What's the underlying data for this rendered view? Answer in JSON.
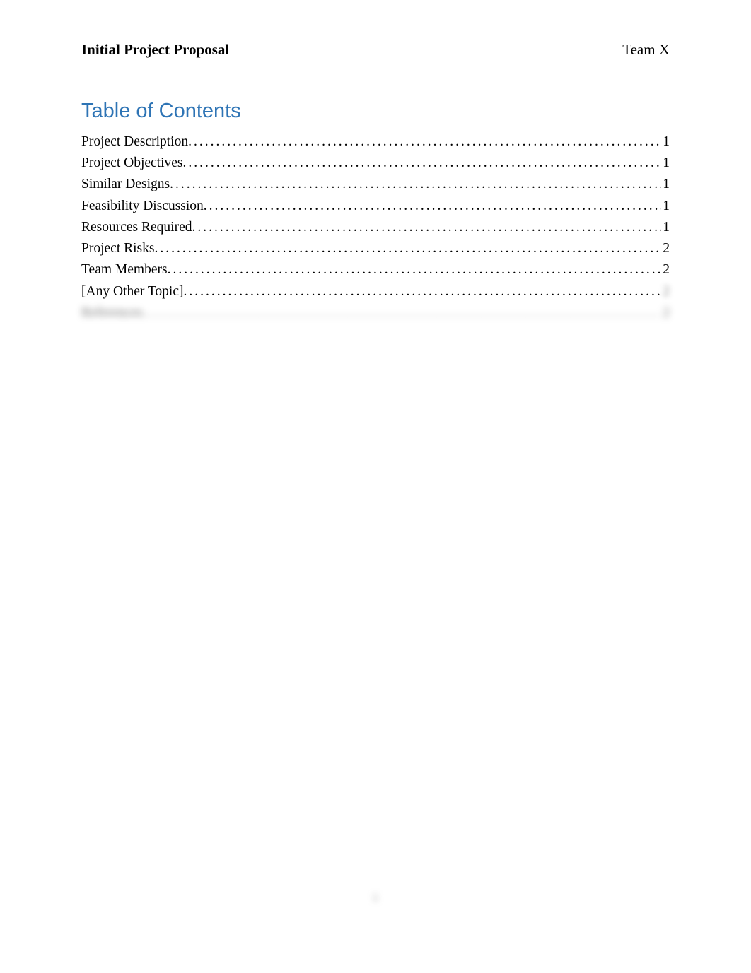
{
  "header": {
    "left": "Initial Project Proposal",
    "right": "Team X"
  },
  "toc": {
    "title": "Table of Contents",
    "entries": [
      {
        "label": "Project Description",
        "page": "1",
        "blurred": false,
        "pageBlurred": false
      },
      {
        "label": "Project Objectives",
        "page": "1",
        "blurred": false,
        "pageBlurred": false
      },
      {
        "label": "Similar Designs",
        "page": "1",
        "blurred": false,
        "pageBlurred": false
      },
      {
        "label": "Feasibility Discussion",
        "page": "1",
        "blurred": false,
        "pageBlurred": false
      },
      {
        "label": "Resources Required",
        "page": "1",
        "blurred": false,
        "pageBlurred": false
      },
      {
        "label": "Project Risks",
        "page": "2",
        "blurred": false,
        "pageBlurred": false
      },
      {
        "label": "Team Members",
        "page": "2",
        "blurred": false,
        "pageBlurred": false
      },
      {
        "label": "[Any Other Topic]",
        "page": "2",
        "blurred": false,
        "pageBlurred": true
      },
      {
        "label": "References",
        "page": "2",
        "blurred": true,
        "pageBlurred": true
      }
    ]
  },
  "footer": {
    "pageNumber": "ii"
  }
}
